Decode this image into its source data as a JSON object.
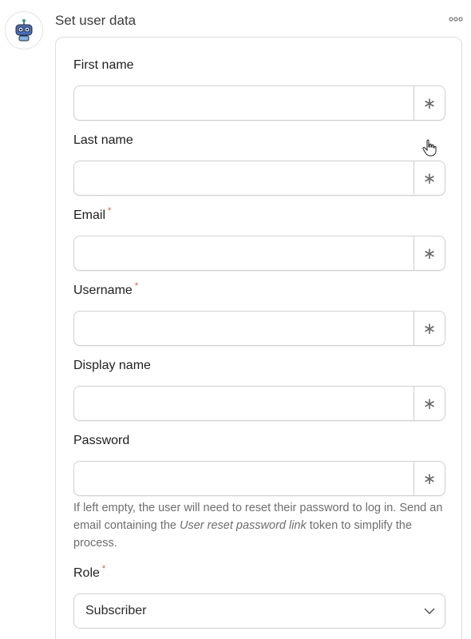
{
  "header": {
    "title": "Set user data",
    "avatar_icon": "robot-icon",
    "more_icon": "more-horizontal-icon"
  },
  "fields": [
    {
      "label": "First name",
      "required": false,
      "value": "",
      "token_symbol": "∗"
    },
    {
      "label": "Last name",
      "required": false,
      "value": "",
      "token_symbol": "∗"
    },
    {
      "label": "Email",
      "required": true,
      "value": "",
      "token_symbol": "∗"
    },
    {
      "label": "Username",
      "required": true,
      "value": "",
      "token_symbol": "∗"
    },
    {
      "label": "Display name",
      "required": false,
      "value": "",
      "token_symbol": "∗"
    },
    {
      "label": "Password",
      "required": false,
      "value": "",
      "token_symbol": "∗"
    }
  ],
  "password_help": {
    "line1": "If left empty, the user will need to reset their password to log in.",
    "part_before": "Send an email containing the ",
    "token_name": "User reset password link",
    "part_after": " token to simplify the process."
  },
  "role": {
    "label": "Role",
    "required": true,
    "selected": "Subscriber"
  },
  "required_marker": "*",
  "colors": {
    "required": "#e0524f",
    "border": "#d0d0d0",
    "help_text": "#6e6e6e",
    "accent_robot": "#2f9e6e"
  }
}
